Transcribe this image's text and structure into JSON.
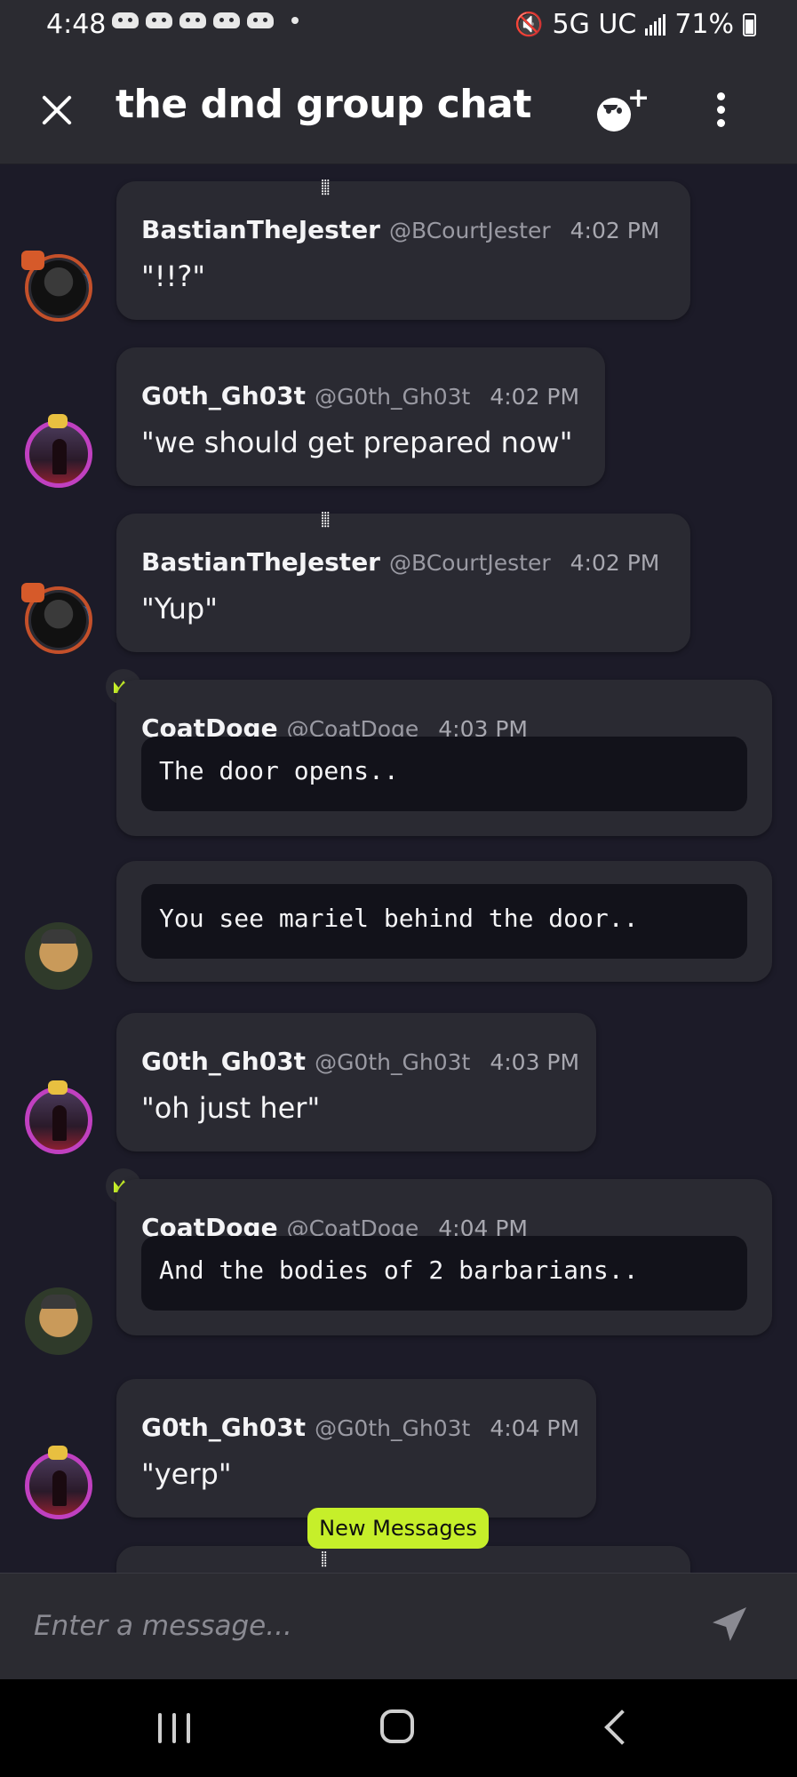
{
  "status_bar": {
    "time": "4:48",
    "network": "5G UC",
    "battery": "71%"
  },
  "header": {
    "title": "the dnd group chat"
  },
  "messages": [
    {
      "name": "BastianTheJester",
      "handle": "@BCourtJester",
      "time": "4:02 PM",
      "text": "\"!!?\""
    },
    {
      "name": "G0th_Gh03t",
      "handle": "@G0th_Gh03t",
      "time": "4:02 PM",
      "text": "\"we should get prepared now\""
    },
    {
      "name": "BastianTheJester",
      "handle": "@BCourtJester",
      "time": "4:02 PM",
      "text": "\"Yup\""
    },
    {
      "name": "CoatDoge",
      "handle": "@CoatDoge",
      "time": "4:03 PM",
      "code": "The door opens.."
    },
    {
      "code": "You see mariel behind the door.."
    },
    {
      "name": "G0th_Gh03t",
      "handle": "@G0th_Gh03t",
      "time": "4:03 PM",
      "text": "\"oh just her\""
    },
    {
      "name": "CoatDoge",
      "handle": "@CoatDoge",
      "time": "4:04 PM",
      "code": "And the bodies of 2 barbarians.."
    },
    {
      "name": "G0th_Gh03t",
      "handle": "@G0th_Gh03t",
      "time": "4:04 PM",
      "text": "\"yerp\""
    }
  ],
  "new_messages_label": "New Messages",
  "composer": {
    "placeholder": "Enter a message..."
  }
}
